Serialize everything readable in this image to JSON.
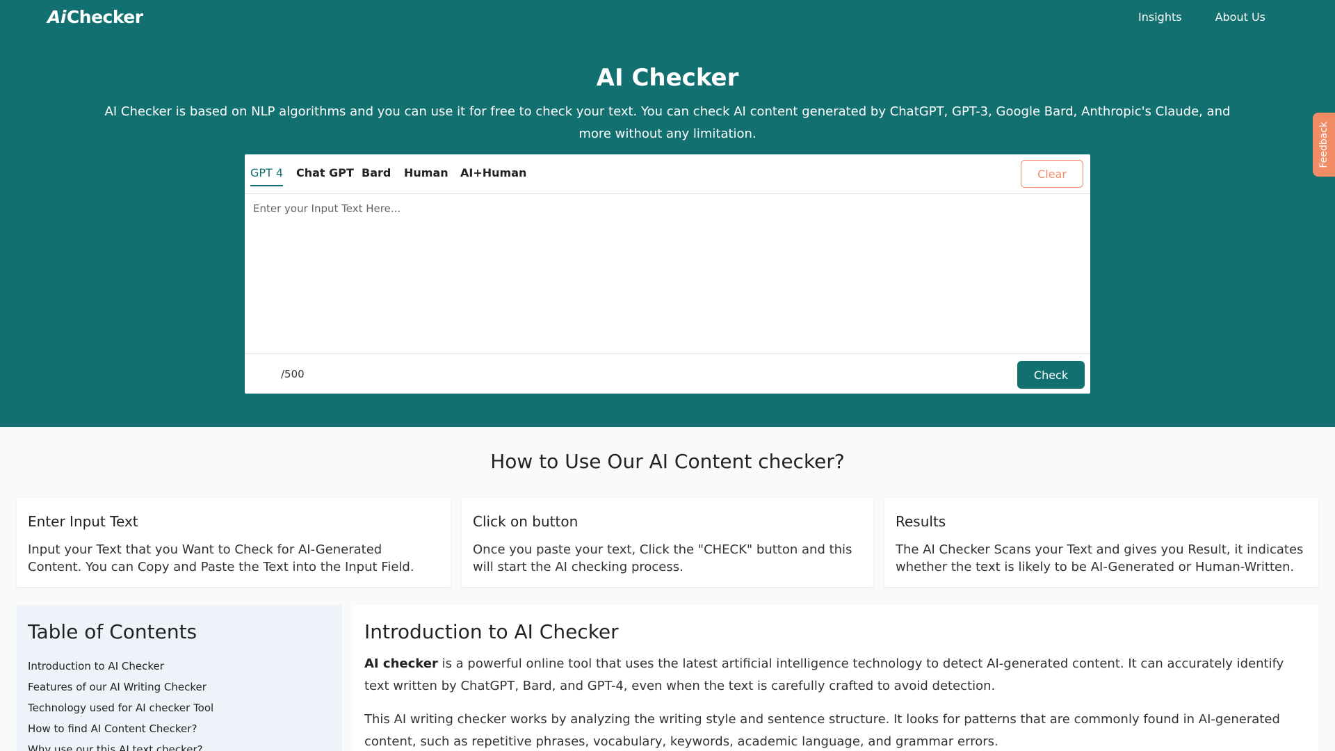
{
  "brand": {
    "logo_mark": "Ai",
    "logo_text": "Checker"
  },
  "nav": {
    "insights": "Insights",
    "about": "About Us"
  },
  "hero": {
    "title": "AI Checker",
    "description": "AI Checker is based on NLP algorithms and you can use it for free to check your text. You can check AI content generated by ChatGPT, GPT-3, Google Bard, Anthropic's Claude, and more without any limitation."
  },
  "feedback": "Feedback",
  "editor": {
    "tabs": [
      "GPT 4",
      "Chat GPT",
      "Bard",
      "Human",
      "AI+Human"
    ],
    "active_tab": "GPT 4",
    "clear_label": "Clear",
    "placeholder": "Enter your Input Text Here...",
    "value": "",
    "counter": "/500",
    "check_label": "Check"
  },
  "how_to": {
    "title": "How to Use Our AI Content checker?",
    "cards": [
      {
        "title": "Enter Input Text",
        "text": "Input your Text that you Want to Check for AI-Generated Content. You can Copy and Paste the Text into the Input Field."
      },
      {
        "title": "Click on button",
        "text": "Once you paste your text, Click the \"CHECK\" button and this will start the AI checking process."
      },
      {
        "title": "Results",
        "text": "The AI Checker Scans your Text and gives you Result, it indicates whether the text is likely to be AI-Generated or Human-Written."
      }
    ]
  },
  "toc": {
    "title": "Table of Contents",
    "items": [
      "Introduction to AI Checker",
      "Features of our AI Writing Checker",
      "Technology used for AI checker Tool",
      "How to find AI Content Checker?",
      "Why use our this AI text checker?"
    ]
  },
  "article": {
    "title": "Introduction to AI Checker",
    "p1_bold": "AI checker",
    "p1_rest": " is a powerful online tool that uses the latest artificial intelligence technology to detect AI-generated content. It can accurately identify text written by ChatGPT, Bard, and GPT-4, even when the text is carefully crafted to avoid detection.",
    "p2": "This AI writing checker works by analyzing the writing style and sentence structure. It looks for patterns that are commonly found in AI-generated content, such as repetitive phrases, vocabulary, keywords, academic language, and grammar errors."
  },
  "colors": {
    "brand": "#137070",
    "accent": "#f08c66",
    "toc_bg": "#eef3f9"
  }
}
